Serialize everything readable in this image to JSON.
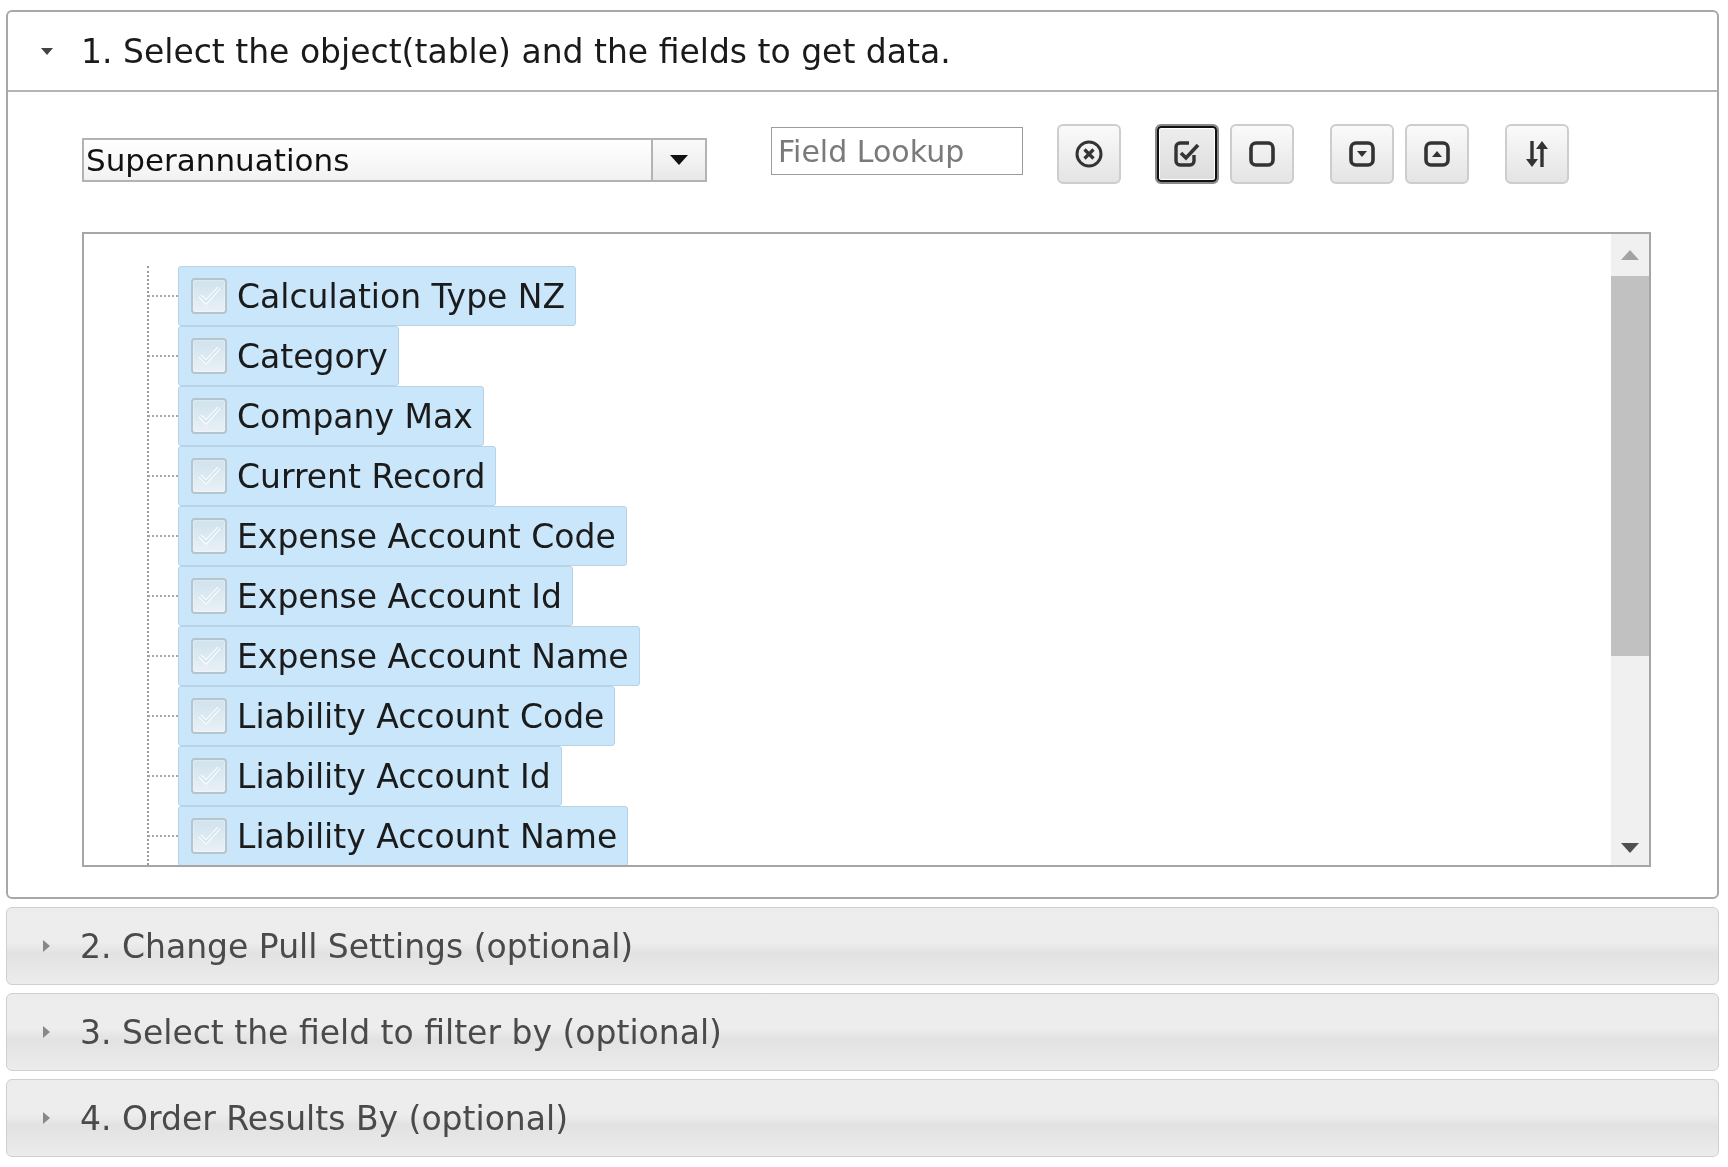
{
  "sections": [
    {
      "title": "1. Select the object(table) and the fields to get data.",
      "expanded": true,
      "object_select": {
        "value": "Superannuations"
      },
      "field_lookup": {
        "placeholder": "Field Lookup"
      },
      "toolbar": [
        {
          "kind": "clear",
          "pressed": false
        },
        {
          "kind": "check-all",
          "pressed": true
        },
        {
          "kind": "uncheck-all",
          "pressed": false
        },
        {
          "kind": "move-down",
          "pressed": false
        },
        {
          "kind": "move-up",
          "pressed": false
        },
        {
          "kind": "sort",
          "pressed": false
        }
      ],
      "fields": [
        {
          "label": "Calculation Type NZ",
          "checked": true
        },
        {
          "label": "Category",
          "checked": true
        },
        {
          "label": "Company Max",
          "checked": true
        },
        {
          "label": "Current Record",
          "checked": true
        },
        {
          "label": "Expense Account Code",
          "checked": true
        },
        {
          "label": "Expense Account Id",
          "checked": true
        },
        {
          "label": "Expense Account Name",
          "checked": true
        },
        {
          "label": "Liability Account Code",
          "checked": true
        },
        {
          "label": "Liability Account Id",
          "checked": true
        },
        {
          "label": "Liability Account Name",
          "checked": true
        }
      ]
    },
    {
      "title": "2. Change Pull Settings (optional)",
      "expanded": false
    },
    {
      "title": "3. Select the field to filter by (optional)",
      "expanded": false
    },
    {
      "title": "4. Order Results By (optional)",
      "expanded": false
    }
  ]
}
